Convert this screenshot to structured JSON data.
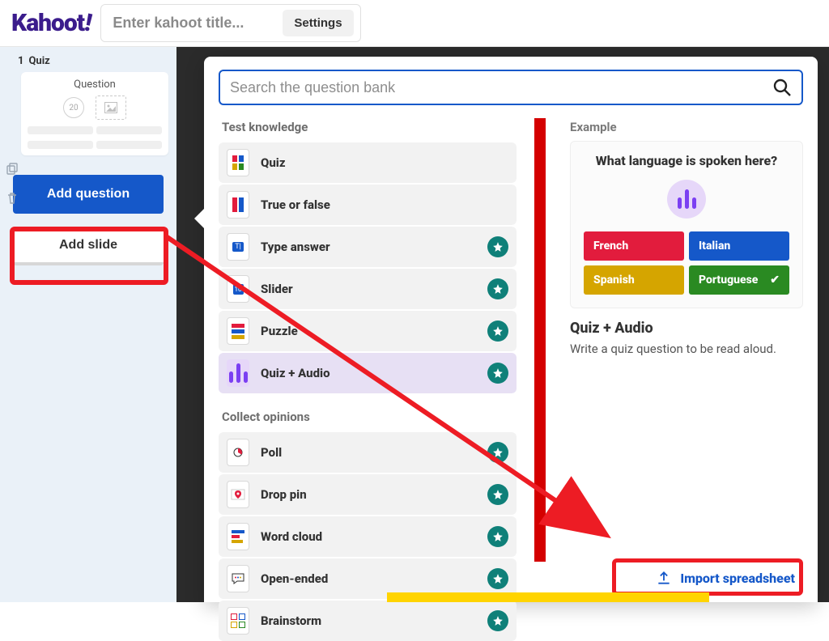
{
  "header": {
    "logo_text": "Kahoot",
    "logo_bang": "!",
    "title_placeholder": "Enter kahoot title...",
    "settings_label": "Settings"
  },
  "sidebar": {
    "slides": [
      {
        "index": "1",
        "type": "Quiz",
        "thumb_title": "Question",
        "time_limit": "20"
      }
    ],
    "add_question_label": "Add question",
    "add_slide_label": "Add slide"
  },
  "popover": {
    "search_placeholder": "Search the question bank",
    "sections": {
      "test_knowledge": {
        "title": "Test knowledge",
        "items": [
          {
            "id": "quiz",
            "label": "Quiz",
            "premium": false
          },
          {
            "id": "true-false",
            "label": "True or false",
            "premium": false
          },
          {
            "id": "type-answer",
            "label": "Type answer",
            "premium": true
          },
          {
            "id": "slider",
            "label": "Slider",
            "premium": true
          },
          {
            "id": "puzzle",
            "label": "Puzzle",
            "premium": true
          },
          {
            "id": "quiz-audio",
            "label": "Quiz + Audio",
            "premium": true,
            "active": true
          }
        ]
      },
      "collect_opinions": {
        "title": "Collect opinions",
        "items": [
          {
            "id": "poll",
            "label": "Poll",
            "premium": true
          },
          {
            "id": "drop-pin",
            "label": "Drop pin",
            "premium": true
          },
          {
            "id": "word-cloud",
            "label": "Word cloud",
            "premium": true
          },
          {
            "id": "open-ended",
            "label": "Open-ended",
            "premium": true
          },
          {
            "id": "brainstorm",
            "label": "Brainstorm",
            "premium": true
          }
        ]
      }
    },
    "example": {
      "heading": "Example",
      "question": "What language is spoken here?",
      "answers": [
        {
          "text": "French",
          "color": "red",
          "correct": false
        },
        {
          "text": "Italian",
          "color": "blue",
          "correct": false
        },
        {
          "text": "Spanish",
          "color": "yellow",
          "correct": false
        },
        {
          "text": "Portuguese",
          "color": "green",
          "correct": true
        }
      ],
      "preview_title": "Quiz + Audio",
      "preview_desc": "Write a quiz question to be read aloud."
    },
    "import_label": "Import spreadsheet"
  },
  "annotations": {
    "highlight_add_question": true,
    "highlight_import": true,
    "arrow_from_add_question_to_import": true
  },
  "colors": {
    "brand_purple": "#3b1c8c",
    "primary_blue": "#1558c9",
    "highlight_red": "#ed1c24",
    "teal": "#0f8079"
  }
}
